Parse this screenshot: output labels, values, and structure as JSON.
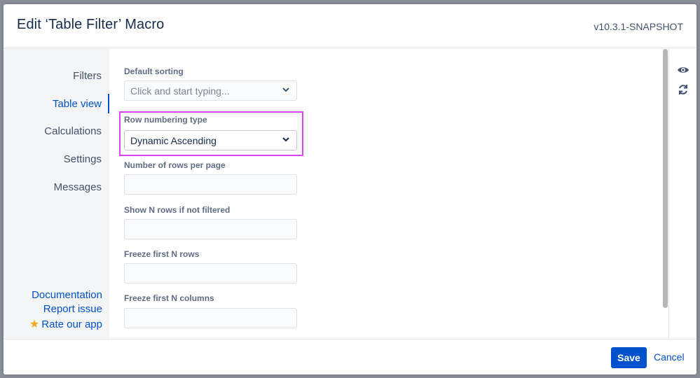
{
  "dialog": {
    "title": "Edit ‘Table Filter’ Macro",
    "version": "v10.3.1-SNAPSHOT"
  },
  "sidebar": {
    "items": [
      {
        "label": "Filters",
        "active": false
      },
      {
        "label": "Table view",
        "active": true
      },
      {
        "label": "Calculations",
        "active": false
      },
      {
        "label": "Settings",
        "active": false
      },
      {
        "label": "Messages",
        "active": false
      }
    ],
    "links": {
      "documentation": "Documentation",
      "report_issue": "Report issue",
      "rate_app": "Rate our app"
    }
  },
  "form": {
    "default_sorting": {
      "label": "Default sorting",
      "placeholder": "Click and start typing..."
    },
    "row_numbering_type": {
      "label": "Row numbering type",
      "value": "Dynamic Ascending"
    },
    "rows_per_page": {
      "label": "Number of rows per page",
      "value": ""
    },
    "show_n_rows": {
      "label": "Show N rows if not filtered",
      "value": ""
    },
    "freeze_rows": {
      "label": "Freeze first N rows",
      "value": ""
    },
    "freeze_columns": {
      "label": "Freeze first N columns",
      "value": ""
    }
  },
  "rail": {
    "icons": [
      "eye-icon",
      "refresh-icon"
    ]
  },
  "footer": {
    "save_label": "Save",
    "cancel_label": "Cancel"
  },
  "colors": {
    "accent": "#0052cc",
    "highlight": "#d946ef",
    "rate_star": "#f5a623"
  }
}
